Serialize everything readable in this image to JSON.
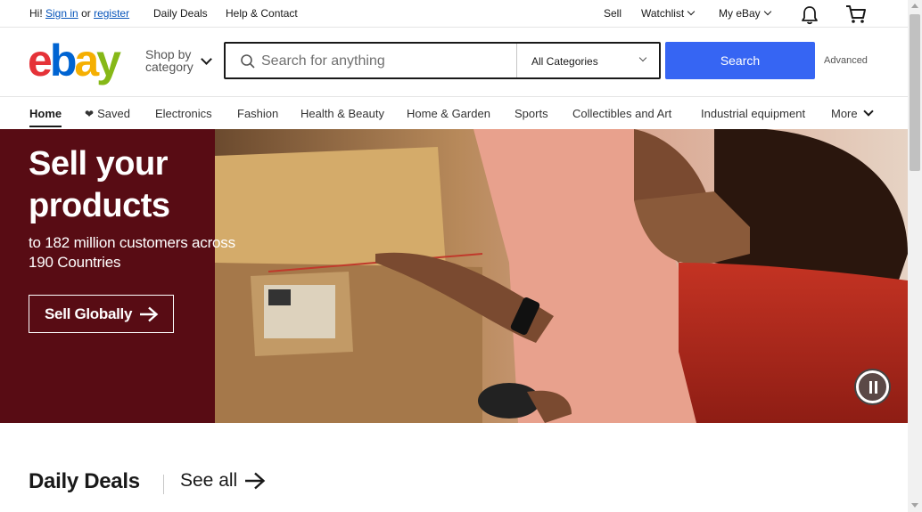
{
  "topbar": {
    "greeting": "Hi!",
    "sign_in": "Sign in",
    "or": "or",
    "register": "register",
    "daily_deals": "Daily Deals",
    "help_contact": "Help & Contact",
    "sell": "Sell",
    "watchlist": "Watchlist",
    "my_ebay": "My eBay"
  },
  "header": {
    "logo_letters": [
      "e",
      "b",
      "a",
      "y"
    ],
    "shop_by_line1": "Shop by",
    "shop_by_line2": "category",
    "search_placeholder": "Search for anything",
    "category_selected": "All Categories",
    "search_button": "Search",
    "advanced": "Advanced"
  },
  "nav": {
    "items": [
      "Home",
      "Saved",
      "Electronics",
      "Fashion",
      "Health & Beauty",
      "Home & Garden",
      "Sports",
      "Collectibles and Art",
      "Industrial equipment",
      "More"
    ]
  },
  "hero": {
    "title_line1": "Sell your",
    "title_line2": "products",
    "subtitle_line1": "to 182 million customers across",
    "subtitle_line2": "190 Countries",
    "cta": "Sell Globally"
  },
  "deals": {
    "title": "Daily Deals",
    "see_all": "See all"
  },
  "colors": {
    "brand_red": "#e53238",
    "brand_blue": "#0064d2",
    "brand_yellow": "#f5af02",
    "brand_green": "#86b817",
    "search_button": "#3665f3",
    "hero_left": "#580c14"
  }
}
